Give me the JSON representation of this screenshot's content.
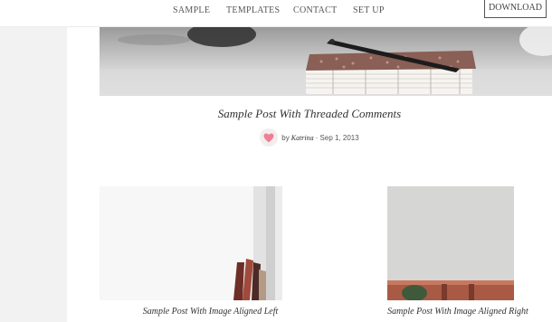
{
  "nav": {
    "items": [
      "SAMPLE",
      "TEMPLATES",
      "CONTACT",
      "SET UP"
    ],
    "download_label": "DOWNLOAD"
  },
  "featured_post": {
    "title": "Sample Post With Threaded Comments",
    "by": "by",
    "author": "Katrina",
    "date": "· Sep 1, 2013"
  },
  "grid_posts": [
    {
      "title": "Sample Post With Image Aligned Left"
    },
    {
      "title": "Sample Post With Image Aligned Right"
    }
  ],
  "colors": {
    "accent_heart": "#f07f96",
    "page_bg": "#f2f2f2",
    "content_bg": "#ffffff"
  },
  "icons": {
    "like": "heart-icon"
  }
}
